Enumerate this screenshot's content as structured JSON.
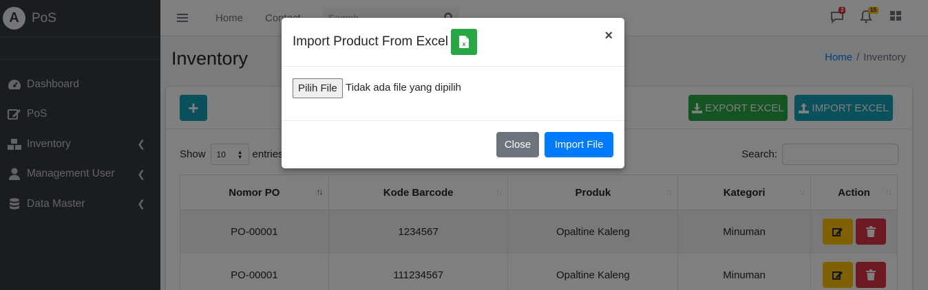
{
  "brand": {
    "logo": "A",
    "name": "PoS"
  },
  "sidebar": {
    "items": [
      {
        "label": "Dashboard",
        "icon": "tachometer-icon",
        "has_children": false
      },
      {
        "label": "PoS",
        "icon": "edit-icon",
        "has_children": false
      },
      {
        "label": "Inventory",
        "icon": "boxes-icon",
        "has_children": true
      },
      {
        "label": "Management User",
        "icon": "user-icon",
        "has_children": true
      },
      {
        "label": "Data Master",
        "icon": "database-icon",
        "has_children": true
      }
    ]
  },
  "topbar": {
    "links": [
      "Home",
      "Contact"
    ],
    "search_placeholder": "Search",
    "messages_count": "3",
    "notifications_count": "15"
  },
  "page": {
    "title": "Inventory",
    "breadcrumb": {
      "home": "Home",
      "current": "Inventory"
    }
  },
  "toolbar": {
    "add_label": "+",
    "export_label": "EXPORT EXCEL",
    "import_label": "IMPORT EXCEL"
  },
  "table_controls": {
    "show_label": "Show",
    "entries_value": "10",
    "entries_label": "entries",
    "search_label": "Search:"
  },
  "table": {
    "headers": [
      "Nomor PO",
      "Kode Barcode",
      "Produk",
      "Kategori",
      "Action"
    ],
    "rows": [
      {
        "po": "PO-00001",
        "barcode": "1234567",
        "produk": "Opaltine Kaleng",
        "kategori": "Minuman"
      },
      {
        "po": "PO-00001",
        "barcode": "111234567",
        "produk": "Opaltine Kaleng",
        "kategori": "Minuman"
      }
    ]
  },
  "modal": {
    "title": "Import Product From Excel",
    "close_x": "×",
    "file_button": "Pilih File",
    "file_status": "Tidak ada file yang dipilih",
    "close_label": "Close",
    "submit_label": "Import File"
  },
  "colors": {
    "sidebar": "#343a40",
    "primary": "#007bff",
    "success": "#28a745",
    "info": "#17a2b8",
    "warning": "#ffc107",
    "danger": "#dc3545",
    "secondary": "#6c757d"
  }
}
